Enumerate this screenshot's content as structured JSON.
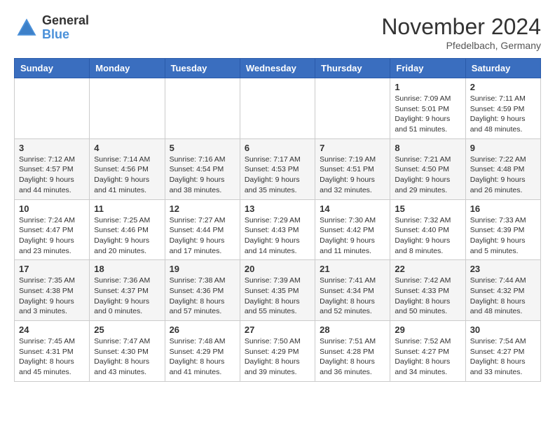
{
  "header": {
    "logo_line1": "General",
    "logo_line2": "Blue",
    "month_title": "November 2024",
    "location": "Pfedelbach, Germany"
  },
  "weekdays": [
    "Sunday",
    "Monday",
    "Tuesday",
    "Wednesday",
    "Thursday",
    "Friday",
    "Saturday"
  ],
  "weeks": [
    [
      {
        "day": "",
        "info": ""
      },
      {
        "day": "",
        "info": ""
      },
      {
        "day": "",
        "info": ""
      },
      {
        "day": "",
        "info": ""
      },
      {
        "day": "",
        "info": ""
      },
      {
        "day": "1",
        "info": "Sunrise: 7:09 AM\nSunset: 5:01 PM\nDaylight: 9 hours\nand 51 minutes."
      },
      {
        "day": "2",
        "info": "Sunrise: 7:11 AM\nSunset: 4:59 PM\nDaylight: 9 hours\nand 48 minutes."
      }
    ],
    [
      {
        "day": "3",
        "info": "Sunrise: 7:12 AM\nSunset: 4:57 PM\nDaylight: 9 hours\nand 44 minutes."
      },
      {
        "day": "4",
        "info": "Sunrise: 7:14 AM\nSunset: 4:56 PM\nDaylight: 9 hours\nand 41 minutes."
      },
      {
        "day": "5",
        "info": "Sunrise: 7:16 AM\nSunset: 4:54 PM\nDaylight: 9 hours\nand 38 minutes."
      },
      {
        "day": "6",
        "info": "Sunrise: 7:17 AM\nSunset: 4:53 PM\nDaylight: 9 hours\nand 35 minutes."
      },
      {
        "day": "7",
        "info": "Sunrise: 7:19 AM\nSunset: 4:51 PM\nDaylight: 9 hours\nand 32 minutes."
      },
      {
        "day": "8",
        "info": "Sunrise: 7:21 AM\nSunset: 4:50 PM\nDaylight: 9 hours\nand 29 minutes."
      },
      {
        "day": "9",
        "info": "Sunrise: 7:22 AM\nSunset: 4:48 PM\nDaylight: 9 hours\nand 26 minutes."
      }
    ],
    [
      {
        "day": "10",
        "info": "Sunrise: 7:24 AM\nSunset: 4:47 PM\nDaylight: 9 hours\nand 23 minutes."
      },
      {
        "day": "11",
        "info": "Sunrise: 7:25 AM\nSunset: 4:46 PM\nDaylight: 9 hours\nand 20 minutes."
      },
      {
        "day": "12",
        "info": "Sunrise: 7:27 AM\nSunset: 4:44 PM\nDaylight: 9 hours\nand 17 minutes."
      },
      {
        "day": "13",
        "info": "Sunrise: 7:29 AM\nSunset: 4:43 PM\nDaylight: 9 hours\nand 14 minutes."
      },
      {
        "day": "14",
        "info": "Sunrise: 7:30 AM\nSunset: 4:42 PM\nDaylight: 9 hours\nand 11 minutes."
      },
      {
        "day": "15",
        "info": "Sunrise: 7:32 AM\nSunset: 4:40 PM\nDaylight: 9 hours\nand 8 minutes."
      },
      {
        "day": "16",
        "info": "Sunrise: 7:33 AM\nSunset: 4:39 PM\nDaylight: 9 hours\nand 5 minutes."
      }
    ],
    [
      {
        "day": "17",
        "info": "Sunrise: 7:35 AM\nSunset: 4:38 PM\nDaylight: 9 hours\nand 3 minutes."
      },
      {
        "day": "18",
        "info": "Sunrise: 7:36 AM\nSunset: 4:37 PM\nDaylight: 9 hours\nand 0 minutes."
      },
      {
        "day": "19",
        "info": "Sunrise: 7:38 AM\nSunset: 4:36 PM\nDaylight: 8 hours\nand 57 minutes."
      },
      {
        "day": "20",
        "info": "Sunrise: 7:39 AM\nSunset: 4:35 PM\nDaylight: 8 hours\nand 55 minutes."
      },
      {
        "day": "21",
        "info": "Sunrise: 7:41 AM\nSunset: 4:34 PM\nDaylight: 8 hours\nand 52 minutes."
      },
      {
        "day": "22",
        "info": "Sunrise: 7:42 AM\nSunset: 4:33 PM\nDaylight: 8 hours\nand 50 minutes."
      },
      {
        "day": "23",
        "info": "Sunrise: 7:44 AM\nSunset: 4:32 PM\nDaylight: 8 hours\nand 48 minutes."
      }
    ],
    [
      {
        "day": "24",
        "info": "Sunrise: 7:45 AM\nSunset: 4:31 PM\nDaylight: 8 hours\nand 45 minutes."
      },
      {
        "day": "25",
        "info": "Sunrise: 7:47 AM\nSunset: 4:30 PM\nDaylight: 8 hours\nand 43 minutes."
      },
      {
        "day": "26",
        "info": "Sunrise: 7:48 AM\nSunset: 4:29 PM\nDaylight: 8 hours\nand 41 minutes."
      },
      {
        "day": "27",
        "info": "Sunrise: 7:50 AM\nSunset: 4:29 PM\nDaylight: 8 hours\nand 39 minutes."
      },
      {
        "day": "28",
        "info": "Sunrise: 7:51 AM\nSunset: 4:28 PM\nDaylight: 8 hours\nand 36 minutes."
      },
      {
        "day": "29",
        "info": "Sunrise: 7:52 AM\nSunset: 4:27 PM\nDaylight: 8 hours\nand 34 minutes."
      },
      {
        "day": "30",
        "info": "Sunrise: 7:54 AM\nSunset: 4:27 PM\nDaylight: 8 hours\nand 33 minutes."
      }
    ]
  ]
}
